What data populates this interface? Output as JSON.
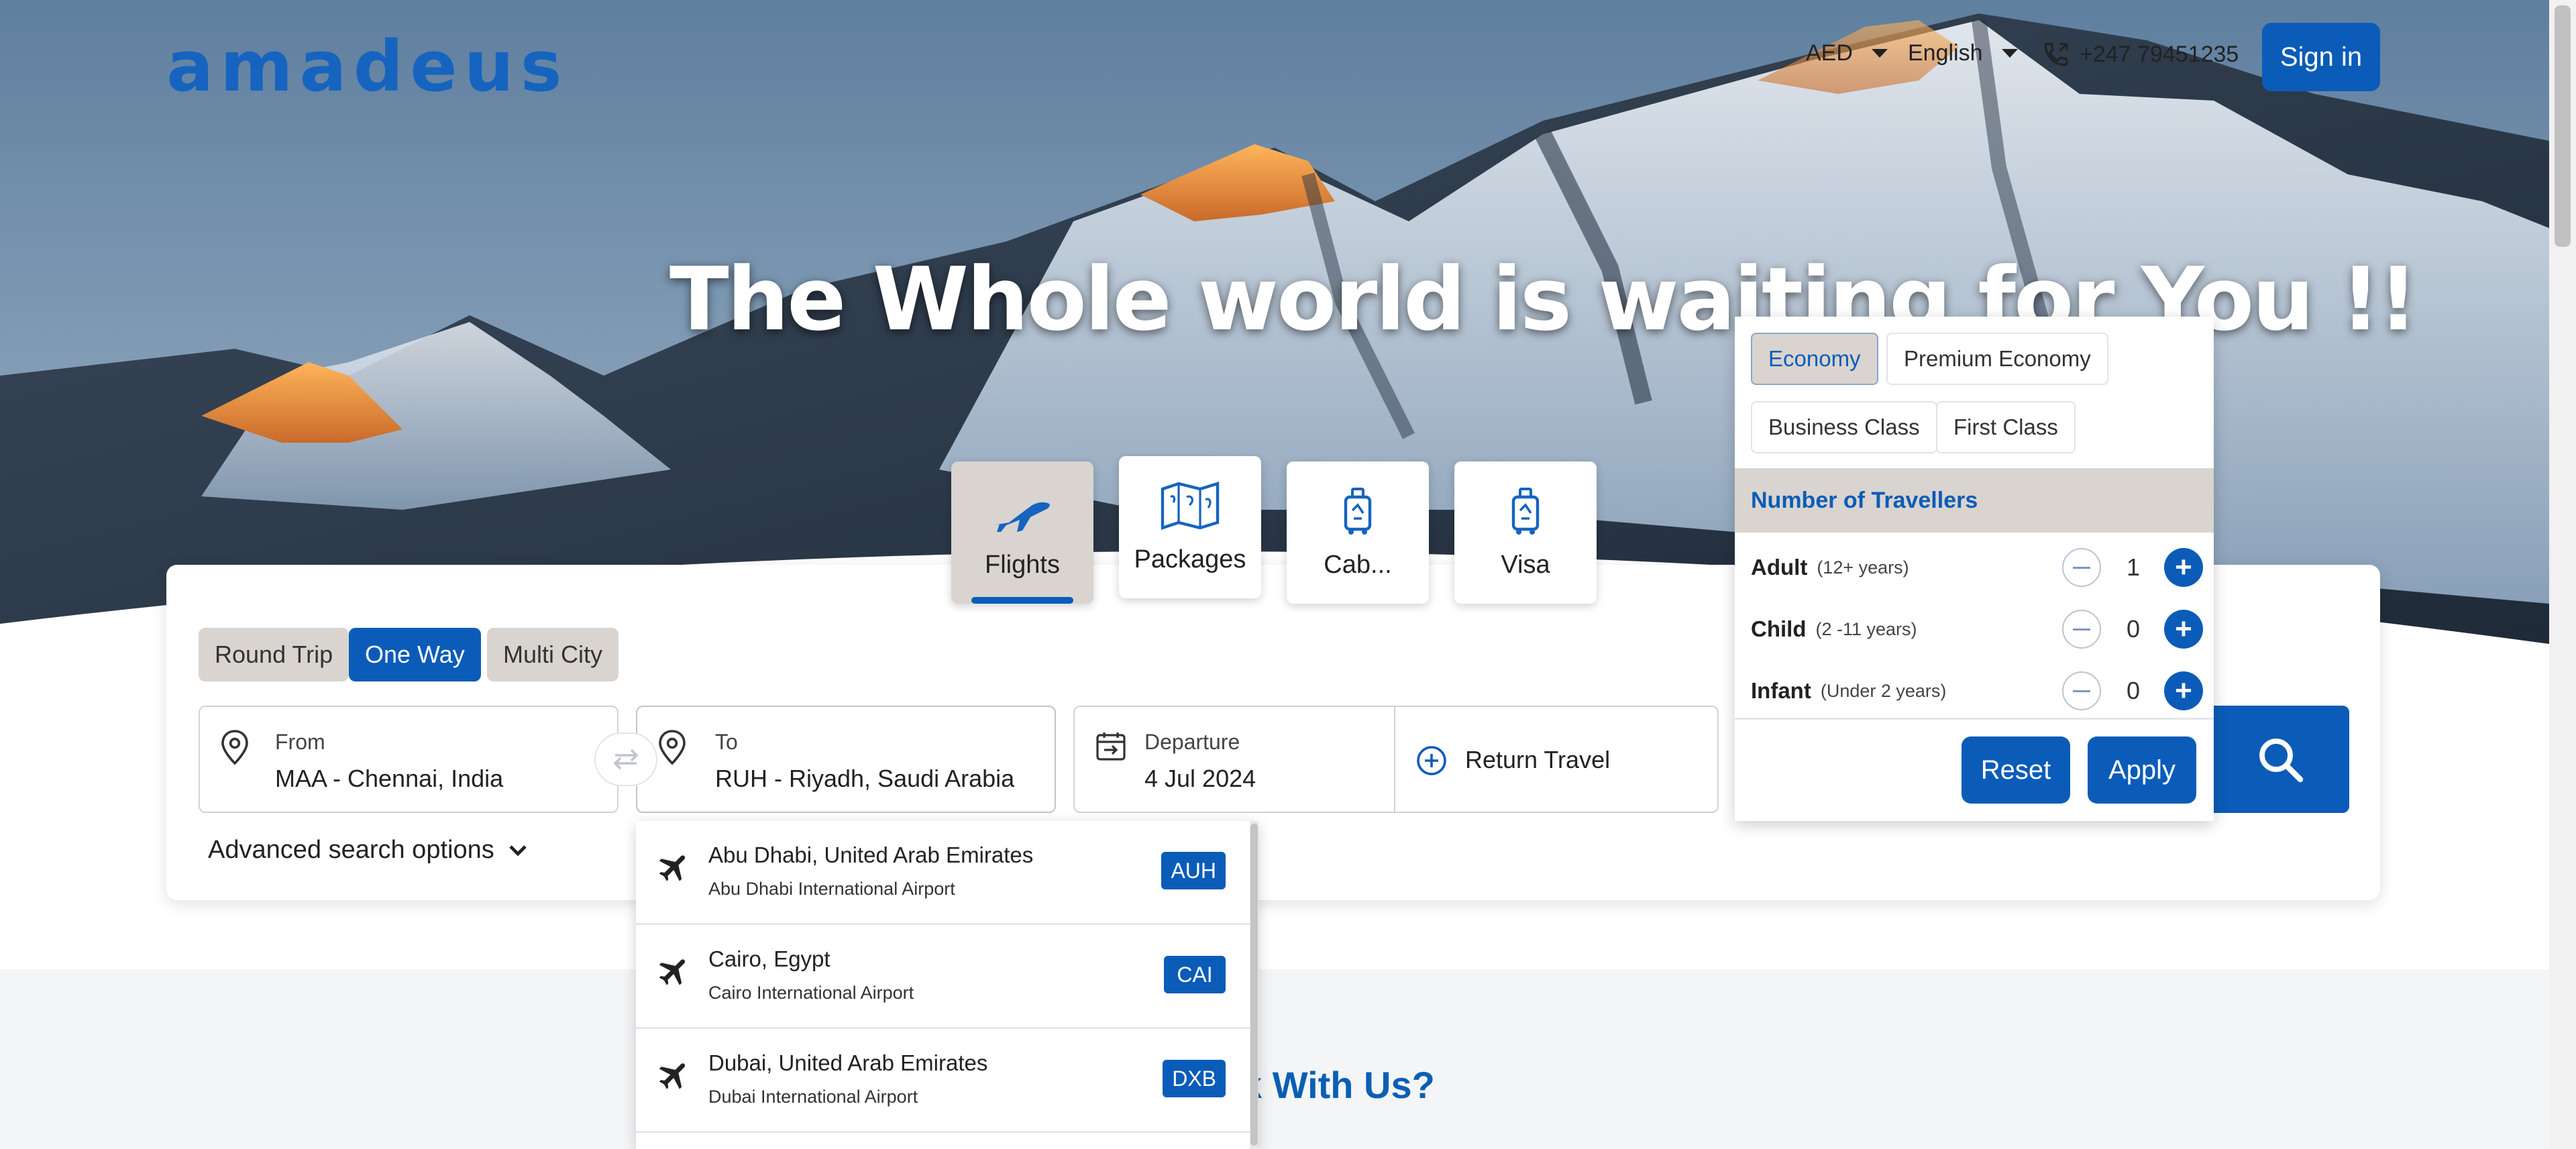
{
  "header": {
    "logo": "amadeus",
    "currency": "AED",
    "language": "English",
    "phone": "+247 79451235",
    "sign_in": "Sign in"
  },
  "hero": {
    "headline": "The Whole world is waiting for You !!"
  },
  "products": [
    {
      "label": "Flights",
      "icon": "plane-icon",
      "active": true
    },
    {
      "label": "Packages",
      "icon": "map-icon",
      "active": false
    },
    {
      "label": "Cab...",
      "icon": "luggage-icon",
      "active": false
    },
    {
      "label": "Visa",
      "icon": "luggage-icon",
      "active": false
    }
  ],
  "trip_types": [
    {
      "label": "Round Trip",
      "selected": false
    },
    {
      "label": "One Way",
      "selected": true
    },
    {
      "label": "Multi City",
      "selected": false
    }
  ],
  "search": {
    "from_label": "From",
    "from_value": "MAA - Chennai, India",
    "to_label": "To",
    "to_value": "RUH - Riyadh, Saudi Arabia",
    "departure_label": "Departure",
    "departure_value": "4 Jul 2024",
    "return_label": "Return Travel",
    "advanced": "Advanced search options"
  },
  "airport_suggestions": [
    {
      "city": "Abu Dhabi, United Arab Emirates",
      "airport": "Abu Dhabi International Airport",
      "code": "AUH"
    },
    {
      "city": "Cairo, Egypt",
      "airport": "Cairo International Airport",
      "code": "CAI"
    },
    {
      "city": "Dubai, United Arab Emirates",
      "airport": "Dubai International Airport",
      "code": "DXB"
    }
  ],
  "cabin_popup": {
    "classes": [
      "Economy",
      "Premium Economy",
      "Business Class",
      "First Class"
    ],
    "selected_class": "Economy",
    "travellers_title": "Number of Travellers",
    "passengers": [
      {
        "name": "Adult",
        "age": "(12+ years)",
        "count": "1"
      },
      {
        "name": "Child",
        "age": "(2 -11 years)",
        "count": "0"
      },
      {
        "name": "Infant",
        "age": "(Under 2 years)",
        "count": "0"
      }
    ],
    "reset": "Reset",
    "apply": "Apply"
  },
  "section_heading_partial": "k With Us?",
  "colors": {
    "brand": "#0b5cb8",
    "chip_bg": "#d9d4cf",
    "logo": "#1664c0"
  }
}
